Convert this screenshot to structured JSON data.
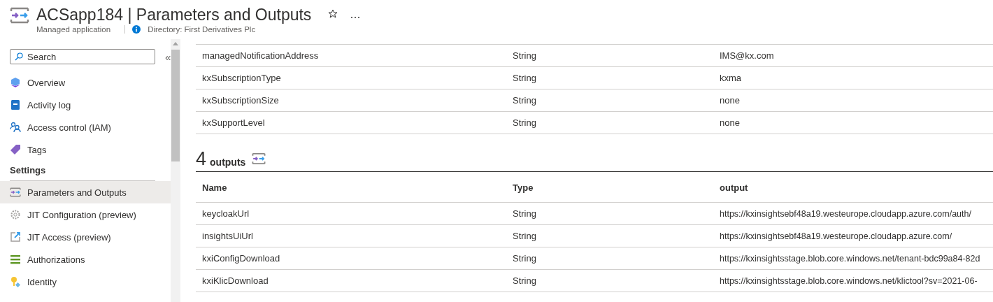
{
  "header": {
    "title": "ACSapp184 | Parameters and Outputs",
    "subtitle": "Managed application",
    "directory": "Directory: First Derivatives Plc"
  },
  "sidebar": {
    "search": {
      "placeholder": "Search"
    },
    "collapse": "«",
    "items": [
      {
        "kind": "link",
        "label": "Overview",
        "selected": false
      },
      {
        "kind": "link",
        "label": "Activity log",
        "selected": false
      },
      {
        "kind": "link",
        "label": "Access control (IAM)",
        "selected": false
      },
      {
        "kind": "link",
        "label": "Tags",
        "selected": false
      },
      {
        "kind": "section",
        "label": "Settings"
      },
      {
        "kind": "link",
        "label": "Parameters and Outputs",
        "selected": true
      },
      {
        "kind": "link",
        "label": "JIT Configuration (preview)",
        "selected": false
      },
      {
        "kind": "link",
        "label": "JIT Access (preview)",
        "selected": false
      },
      {
        "kind": "link",
        "label": "Authorizations",
        "selected": false
      },
      {
        "kind": "link",
        "label": "Identity",
        "selected": false
      }
    ]
  },
  "parameters": {
    "rows": [
      [
        "managedNotificationAddress",
        "String",
        "IMS@kx.com"
      ],
      [
        "kxSubscriptionType",
        "String",
        "kxma"
      ],
      [
        "kxSubscriptionSize",
        "String",
        "none"
      ],
      [
        "kxSupportLevel",
        "String",
        "none"
      ]
    ]
  },
  "outputs": {
    "count": "4",
    "label": "outputs",
    "columns": [
      "Name",
      "Type",
      "output"
    ],
    "rows": [
      [
        "keycloakUrl",
        "String",
        "https://kxinsightsebf48a19.westeurope.cloudapp.azure.com/auth/"
      ],
      [
        "insightsUiUrl",
        "String",
        "https://kxinsightsebf48a19.westeurope.cloudapp.azure.com/"
      ],
      [
        "kxiConfigDownload",
        "String",
        "https://kxinsightsstage.blob.core.windows.net/tenant-bdc99a84-82d"
      ],
      [
        "kxiKlicDownload",
        "String",
        "https://kxinsightsstage.blob.core.windows.net/klictool?sv=2021-06-"
      ]
    ]
  }
}
